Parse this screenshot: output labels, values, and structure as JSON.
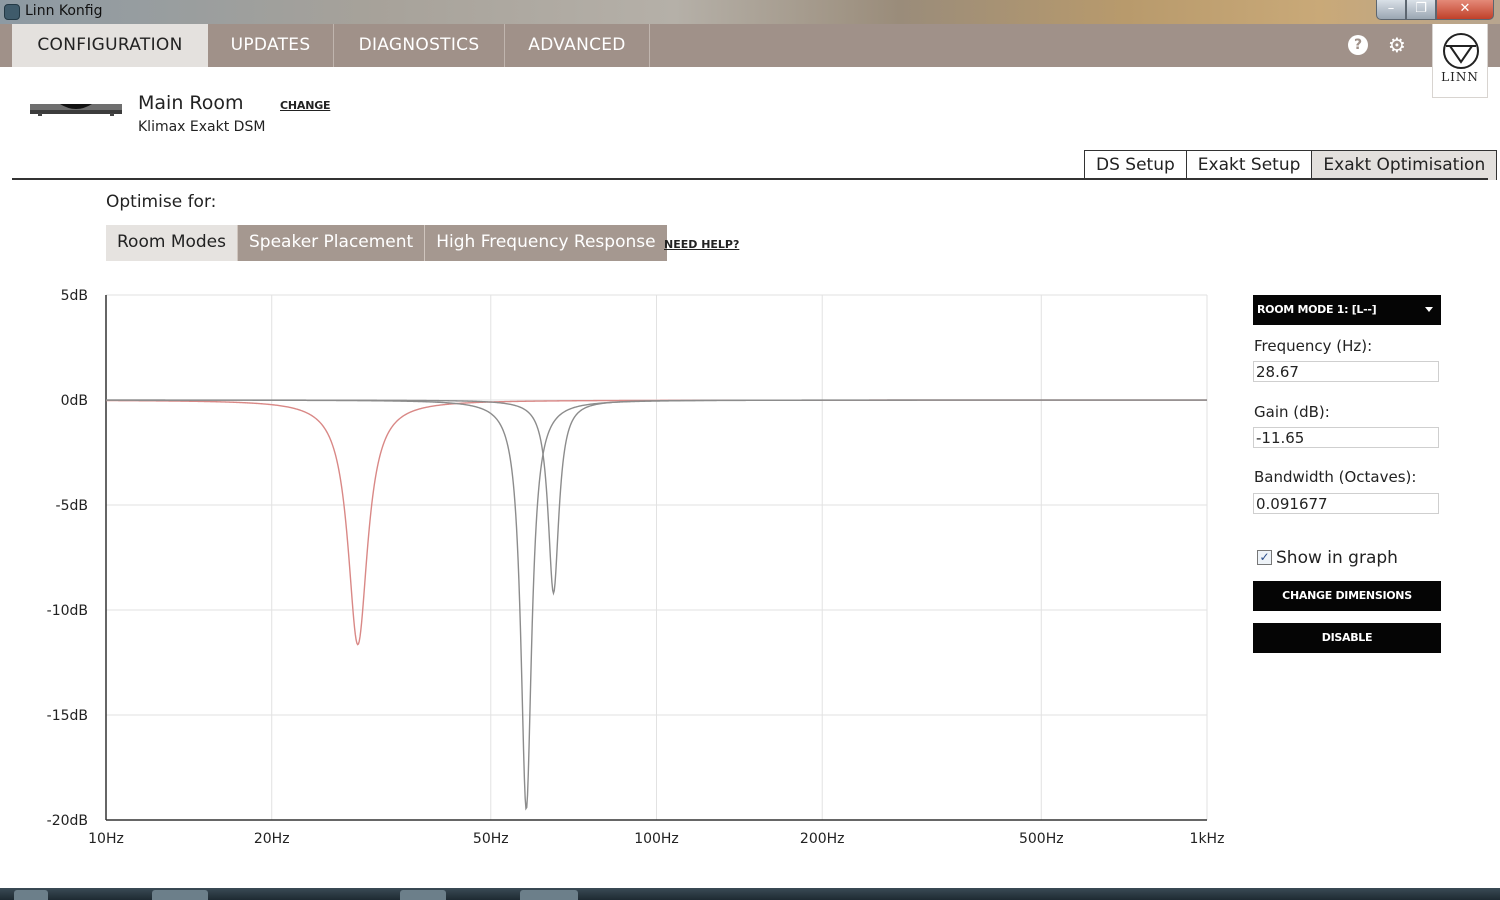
{
  "window": {
    "title": "Linn Konfig"
  },
  "nav": {
    "tabs": [
      {
        "label": "CONFIGURATION"
      },
      {
        "label": "UPDATES"
      },
      {
        "label": "DIAGNOSTICS"
      },
      {
        "label": "ADVANCED"
      }
    ],
    "help_glyph": "?",
    "gear_glyph": "⚙",
    "logo_text": "LINN"
  },
  "device": {
    "room": "Main Room",
    "change_label": "CHANGE",
    "model": "Klimax Exakt DSM"
  },
  "subtabs": [
    {
      "label": "DS Setup"
    },
    {
      "label": "Exakt Setup"
    },
    {
      "label": "Exakt Optimisation"
    }
  ],
  "optimise": {
    "label": "Optimise for:",
    "tabs": [
      {
        "label": "Room Modes"
      },
      {
        "label": "Speaker Placement"
      },
      {
        "label": "High Frequency Response"
      }
    ],
    "help_label": "NEED HELP?"
  },
  "panel": {
    "mode_select": "ROOM MODE 1: [L--]",
    "frequency_label": "Frequency (Hz):",
    "frequency_value": "28.67",
    "gain_label": "Gain (dB):",
    "gain_value": "-11.65",
    "bandwidth_label": "Bandwidth (Octaves):",
    "bandwidth_value": "0.091677",
    "show_label": "Show in graph",
    "show_checked": true,
    "change_dimensions_label": "CHANGE DIMENSIONS",
    "disable_label": "DISABLE"
  },
  "chart_data": {
    "type": "line",
    "x_scale": "log",
    "xlim": [
      10,
      1000
    ],
    "ylim": [
      -20,
      5
    ],
    "grid": true,
    "x_ticks": [
      {
        "value": 10,
        "label": "10Hz"
      },
      {
        "value": 20,
        "label": "20Hz"
      },
      {
        "value": 50,
        "label": "50Hz"
      },
      {
        "value": 100,
        "label": "100Hz"
      },
      {
        "value": 200,
        "label": "200Hz"
      },
      {
        "value": 500,
        "label": "500Hz"
      },
      {
        "value": 1000,
        "label": "1kHz"
      }
    ],
    "y_ticks": [
      {
        "value": 5,
        "label": "5dB"
      },
      {
        "value": 0,
        "label": "0dB"
      },
      {
        "value": -5,
        "label": "-5dB"
      },
      {
        "value": -10,
        "label": "-10dB"
      },
      {
        "value": -15,
        "label": "-15dB"
      },
      {
        "value": -20,
        "label": "-20dB"
      }
    ],
    "series": [
      {
        "color": "#d98886",
        "modes": [
          {
            "freq": 28.67,
            "gain": -11.65,
            "bw": 0.091677
          }
        ]
      },
      {
        "color": "#8c8c8c",
        "modes": [
          {
            "freq": 58,
            "gain": -19.5,
            "bw": 0.05
          }
        ]
      },
      {
        "color": "#8c8c8c",
        "modes": [
          {
            "freq": 65,
            "gain": -9.2,
            "bw": 0.05
          }
        ]
      }
    ]
  }
}
